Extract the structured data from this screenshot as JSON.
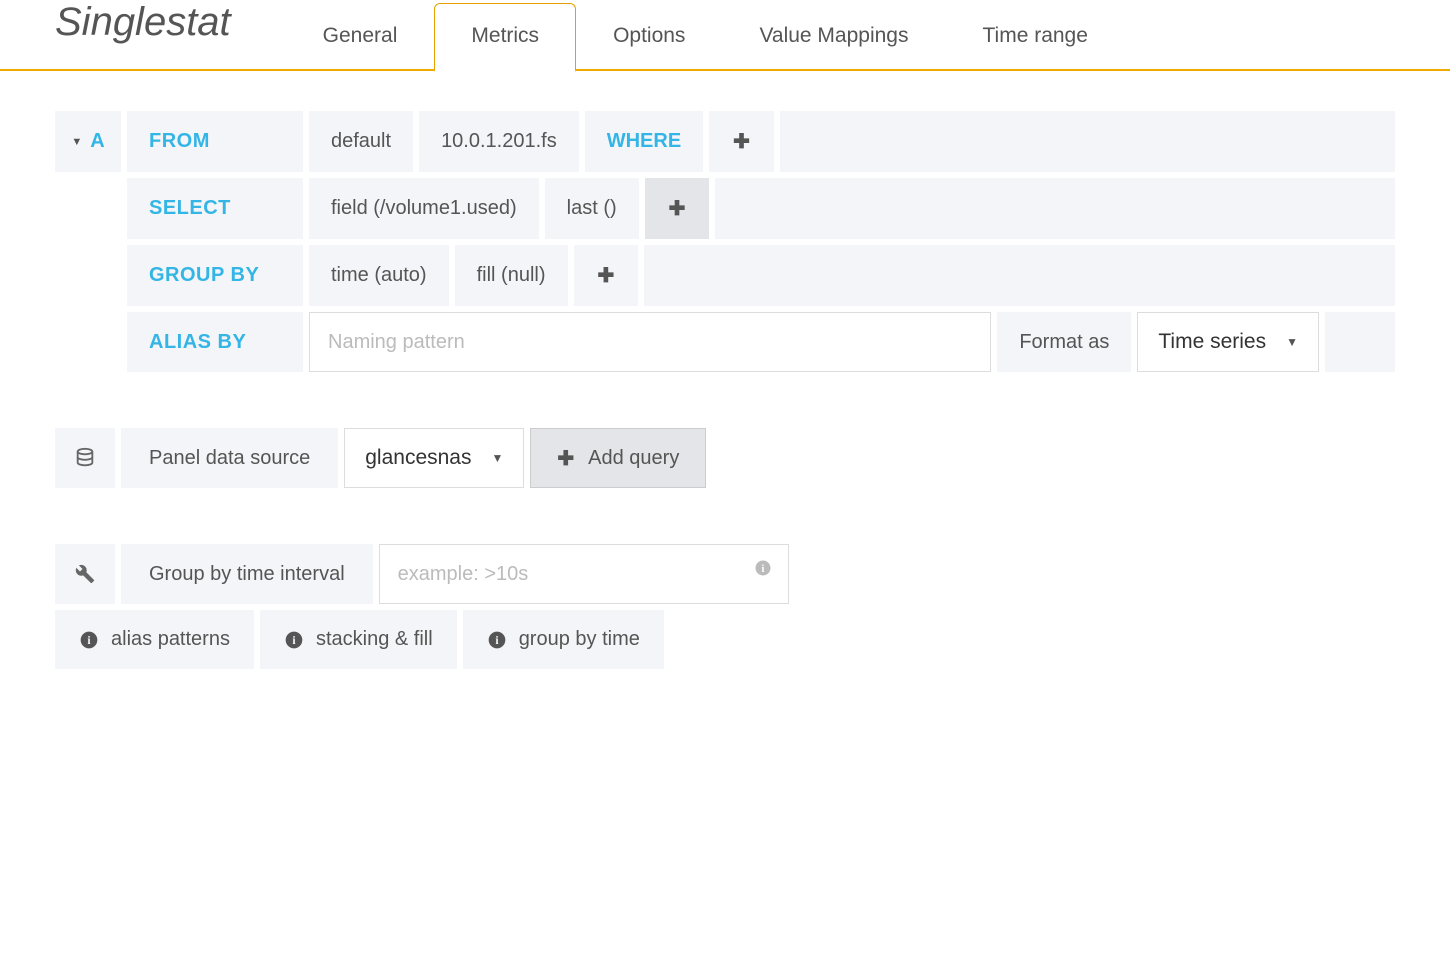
{
  "page": {
    "title": "Singlestat",
    "tabs": [
      "General",
      "Metrics",
      "Options",
      "Value Mappings",
      "Time range"
    ],
    "activeTab": 1
  },
  "query": {
    "letter": "A",
    "from": {
      "label": "FROM",
      "policy": "default",
      "measurement": "10.0.1.201.fs",
      "whereLabel": "WHERE"
    },
    "select": {
      "label": "SELECT",
      "field": "field (/volume1.used)",
      "agg": "last ()"
    },
    "groupby": {
      "label": "GROUP BY",
      "time": "time (auto)",
      "fill": "fill (null)"
    },
    "alias": {
      "label": "ALIAS BY",
      "placeholder": "Naming pattern",
      "formatAsLabel": "Format as",
      "formatAs": "Time series"
    }
  },
  "datasource": {
    "label": "Panel data source",
    "value": "glancesnas",
    "addQueryLabel": "Add query"
  },
  "interval": {
    "label": "Group by time interval",
    "placeholder": "example: >10s"
  },
  "help": {
    "alias": "alias patterns",
    "stacking": "stacking & fill",
    "groupby": "group by time"
  }
}
